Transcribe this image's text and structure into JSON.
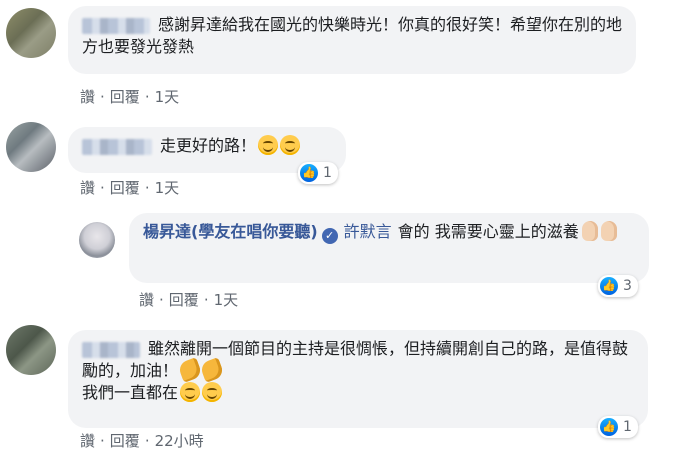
{
  "comments": [
    {
      "text": "感謝昇達給我在國光的快樂時光！你真的很好笑！希望你在別的地方也要發光發熱",
      "actions": {
        "like": "讚",
        "reply": "回覆",
        "time": "1天"
      }
    },
    {
      "text": "走更好的路！",
      "actions": {
        "like": "讚",
        "reply": "回覆",
        "time": "1天"
      },
      "reaction": {
        "icon": "thumbs-up-icon",
        "count": "1"
      }
    },
    {
      "author": "楊昇達(學友在唱你要聽)",
      "mention": "許默言",
      "text": "會的 我需要心靈上的滋養",
      "actions": {
        "like": "讚",
        "reply": "回覆",
        "time": "1天"
      },
      "reaction": {
        "icon": "thumbs-up-icon",
        "count": "3"
      }
    },
    {
      "text_line1": "雖然離開一個節目的主持是很惆悵，但持續開創自己的路，是值得鼓勵的，加油！",
      "text_line2": "我們一直都在",
      "actions": {
        "like": "讚",
        "reply": "回覆",
        "time": "22小時"
      },
      "reaction": {
        "icon": "thumbs-up-icon",
        "count": "1"
      }
    }
  ],
  "colors": {
    "bubble": "#f2f3f5",
    "author": "#385898",
    "meta": "#606770",
    "like_blue": "#1877f2"
  }
}
